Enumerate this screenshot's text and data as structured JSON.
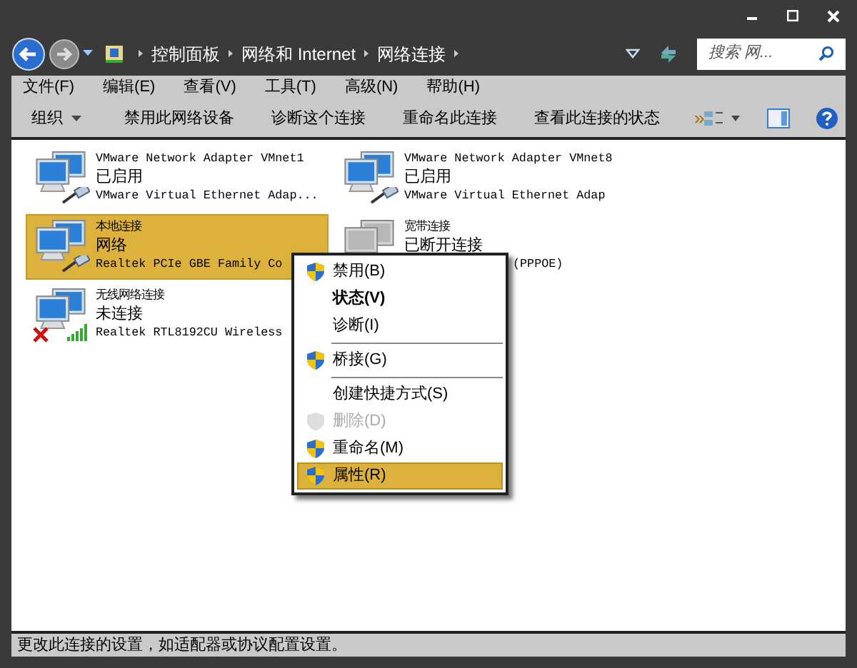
{
  "address_bar": {
    "breadcrumb": [
      "控制面板",
      "网络和 Internet",
      "网络连接"
    ],
    "search_placeholder": "搜索 网..."
  },
  "menu_bar": [
    "文件(F)",
    "编辑(E)",
    "查看(V)",
    "工具(T)",
    "高级(N)",
    "帮助(H)"
  ],
  "toolbar": {
    "organize": "组织",
    "buttons": [
      "禁用此网络设备",
      "诊断这个连接",
      "重命名此连接",
      "查看此连接的状态"
    ],
    "more": "»"
  },
  "connections": [
    {
      "name": "VMware Network Adapter VMnet1",
      "status": "已启用",
      "device": "VMware Virtual Ethernet Adap...",
      "kind": "wired",
      "greyed": false,
      "error": false,
      "selected": false
    },
    {
      "name": "VMware Network Adapter VMnet8",
      "status": "已启用",
      "device": "VMware Virtual Ethernet Adap",
      "kind": "wired",
      "greyed": false,
      "error": false,
      "selected": false
    },
    {
      "name": "本地连接",
      "status": "网络",
      "device": "Realtek PCIe GBE Family Co",
      "kind": "wired",
      "greyed": false,
      "error": false,
      "selected": true
    },
    {
      "name": "宽带连接",
      "status": "已断开连接",
      "device": "(PPPOE)",
      "kind": "broadband",
      "greyed": true,
      "error": false,
      "selected": false
    },
    {
      "name": "无线网络连接",
      "status": "未连接",
      "device": "Realtek RTL8192CU Wireless",
      "kind": "wireless",
      "greyed": false,
      "error": true,
      "selected": false
    }
  ],
  "context_menu": [
    {
      "kind": "item",
      "label": "禁用(B)",
      "shield": true,
      "bold": false,
      "disabled": false,
      "selected": false
    },
    {
      "kind": "item",
      "label": "状态(V)",
      "shield": false,
      "bold": true,
      "disabled": false,
      "selected": false
    },
    {
      "kind": "item",
      "label": "诊断(I)",
      "shield": false,
      "bold": false,
      "disabled": false,
      "selected": false
    },
    {
      "kind": "separator"
    },
    {
      "kind": "item",
      "label": "桥接(G)",
      "shield": true,
      "bold": false,
      "disabled": false,
      "selected": false
    },
    {
      "kind": "separator"
    },
    {
      "kind": "item",
      "label": "创建快捷方式(S)",
      "shield": false,
      "bold": false,
      "disabled": false,
      "selected": false
    },
    {
      "kind": "item",
      "label": "删除(D)",
      "shield": true,
      "bold": false,
      "disabled": true,
      "selected": false
    },
    {
      "kind": "item",
      "label": "重命名(M)",
      "shield": true,
      "bold": false,
      "disabled": false,
      "selected": false
    },
    {
      "kind": "item",
      "label": "属性(R)",
      "shield": true,
      "bold": false,
      "disabled": false,
      "selected": true
    }
  ],
  "status_bar": "更改此连接的设置，如适配器或协议配置设置。"
}
